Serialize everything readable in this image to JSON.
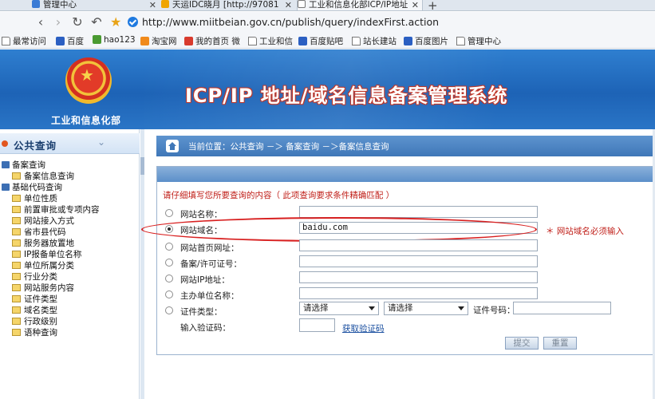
{
  "browser": {
    "tabs": [
      {
        "title": "管理中心",
        "active": false
      },
      {
        "title": "天运IDC晓月 [http://97081",
        "active": false
      },
      {
        "title": "工业和信息化部ICP/IP地址",
        "active": true
      }
    ],
    "new_tab_symbol": "+",
    "url": "http://www.miitbeian.gov.cn/publish/query/indexFirst.action",
    "bookmarks": [
      {
        "label": "最常访问",
        "icon": "page-icon"
      },
      {
        "label": "百度",
        "icon": "paw-icon"
      },
      {
        "label": "hao123",
        "icon": "hao123-icon"
      },
      {
        "label": "淘宝网",
        "icon": "taobao-icon"
      },
      {
        "label": "我的首页 微",
        "icon": "weibo-icon"
      },
      {
        "label": "工业和信",
        "icon": "page-icon"
      },
      {
        "label": "百度贴吧",
        "icon": "paw-icon"
      },
      {
        "label": "站长建站",
        "icon": "page-icon"
      },
      {
        "label": "百度图片",
        "icon": "paw-icon"
      },
      {
        "label": "管理中心",
        "icon": "page-icon"
      }
    ]
  },
  "header": {
    "ministry": "工业和信息化部",
    "system_title": "ICP/IP 地址/域名信息备案管理系统"
  },
  "sidebar": {
    "title": "公共查询",
    "groups": [
      {
        "label": "备案查询",
        "items": [
          "备案信息查询"
        ]
      },
      {
        "label": "基础代码查询",
        "items": [
          "单位性质",
          "前置审批或专项内容",
          "网站接入方式",
          "省市县代码",
          "服务器放置地",
          "IP报备单位名称",
          "单位所属分类",
          "行业分类",
          "网站服务内容",
          "证件类型",
          "域名类型",
          "行政级别",
          "语种查询"
        ]
      }
    ]
  },
  "breadcrumb": "当前位置：公共查询 －＞ 备案查询 －＞备案信息查询",
  "form": {
    "hint": "请仔细填写您所要查询的内容（ 此项查询要求条件精确匹配 ）",
    "fields": [
      {
        "label": "网站名称：",
        "value": "",
        "checked": false
      },
      {
        "label": "网站域名：",
        "value": "baidu.com",
        "checked": true
      },
      {
        "label": "网站首页网址：",
        "value": "",
        "checked": false
      },
      {
        "label": "备案/许可证号：",
        "value": "",
        "checked": false
      },
      {
        "label": "网站IP地址：",
        "value": "",
        "checked": false
      },
      {
        "label": "主办单位名称：",
        "value": "",
        "checked": false
      }
    ],
    "domain_required": "＊ 网站域名必须输入",
    "cert": {
      "label": "证件类型：",
      "select1": "请选择",
      "select2": "请选择",
      "number_label": "证件号码："
    },
    "vcode": {
      "label": "输入验证码：",
      "link": "获取验证码"
    },
    "buttons": {
      "submit": "提交",
      "reset": "重置"
    }
  },
  "colors": {
    "header_blue": "#1d63b6",
    "hint_red": "#c0201a",
    "ellipse_red": "#d82020",
    "crumb_blue": "#3f77b8"
  }
}
